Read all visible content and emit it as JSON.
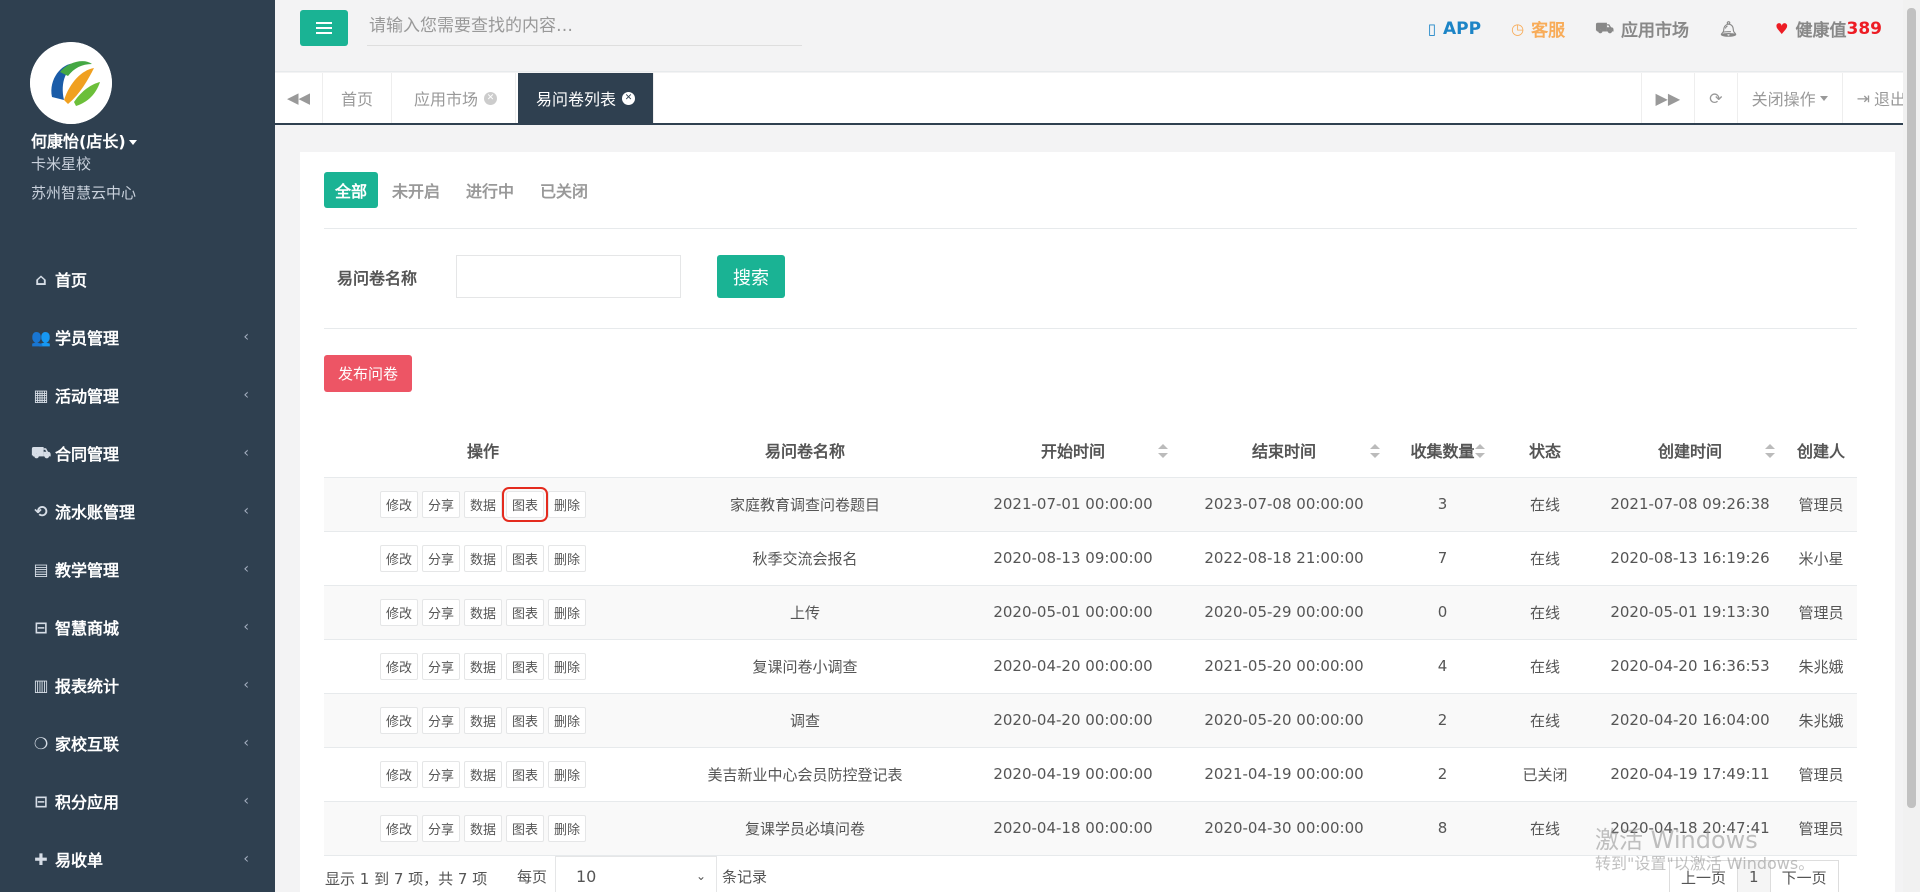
{
  "sidebar": {
    "user_name": "何康怡(店长)",
    "school": "卡米星校",
    "center": "苏州智慧云中心",
    "items": [
      {
        "label": "首页",
        "icon": "home-icon"
      },
      {
        "label": "学员管理",
        "icon": "users-icon"
      },
      {
        "label": "活动管理",
        "icon": "map-icon"
      },
      {
        "label": "合同管理",
        "icon": "cart-icon"
      },
      {
        "label": "流水账管理",
        "icon": "refresh-icon"
      },
      {
        "label": "教学管理",
        "icon": "calendar-icon"
      },
      {
        "label": "智慧商城",
        "icon": "inbox-icon"
      },
      {
        "label": "报表统计",
        "icon": "bar-chart-icon"
      },
      {
        "label": "家校互联",
        "icon": "comments-icon"
      },
      {
        "label": "积分应用",
        "icon": "inbox-icon"
      },
      {
        "label": "易收单",
        "icon": "user-plus-icon"
      }
    ]
  },
  "topbar": {
    "search_placeholder": "请输入您需要查找的内容…",
    "app_label": "APP",
    "kefu_label": "客服",
    "market_label": "应用市场",
    "health_label": "健康值",
    "health_value": "389"
  },
  "tabs": {
    "items": [
      "首页",
      "应用市场",
      "易问卷列表"
    ],
    "close_ops": "关闭操作",
    "logout": "退出"
  },
  "filters": {
    "items": [
      "全部",
      "未开启",
      "进行中",
      "已关闭"
    ]
  },
  "search": {
    "label": "易问卷名称",
    "button": "搜索",
    "publish": "发布问卷"
  },
  "table": {
    "headers": [
      "操作",
      "易问卷名称",
      "开始时间",
      "结束时间",
      "收集数量",
      "状态",
      "创建时间",
      "创建人"
    ],
    "op_labels": [
      "修改",
      "分享",
      "数据",
      "图表",
      "删除"
    ],
    "rows": [
      {
        "name": "家庭教育调查问卷题目",
        "start": "2021-07-01 00:00:00",
        "end": "2023-07-08 00:00:00",
        "count": "3",
        "status": "在线",
        "created": "2021-07-08 09:26:38",
        "creator": "管理员"
      },
      {
        "name": "秋季交流会报名",
        "start": "2020-08-13 09:00:00",
        "end": "2022-08-18 21:00:00",
        "count": "7",
        "status": "在线",
        "created": "2020-08-13 16:19:26",
        "creator": "米小星"
      },
      {
        "name": "上传",
        "start": "2020-05-01 00:00:00",
        "end": "2020-05-29 00:00:00",
        "count": "0",
        "status": "在线",
        "created": "2020-05-01 19:13:30",
        "creator": "管理员"
      },
      {
        "name": "复课问卷小调查",
        "start": "2020-04-20 00:00:00",
        "end": "2021-05-20 00:00:00",
        "count": "4",
        "status": "在线",
        "created": "2020-04-20 16:36:53",
        "creator": "朱兆娥"
      },
      {
        "name": "调查",
        "start": "2020-04-20 00:00:00",
        "end": "2020-05-20 00:00:00",
        "count": "2",
        "status": "在线",
        "created": "2020-04-20 16:04:00",
        "creator": "朱兆娥"
      },
      {
        "name": "美吉新业中心会员防控登记表",
        "start": "2020-04-19 00:00:00",
        "end": "2021-04-19 00:00:00",
        "count": "2",
        "status": "已关闭",
        "created": "2020-04-19 17:49:11",
        "creator": "管理员"
      },
      {
        "name": "复课学员必填问卷",
        "start": "2020-04-18 00:00:00",
        "end": "2020-04-30 00:00:00",
        "count": "8",
        "status": "在线",
        "created": "2020-04-18 20:47:41",
        "creator": "管理员"
      }
    ]
  },
  "footer": {
    "info": "显示 1 到 7 项，共 7 项",
    "per_page": "每页",
    "page_size": "10",
    "records": "条记录",
    "prev": "上一页",
    "page": "1",
    "next": "下一页"
  },
  "watermark": {
    "line1": "激活 Windows",
    "line2": "转到\"设置\"以激活 Windows。"
  },
  "colors": {
    "sidebar_bg": "#2f4050",
    "primary": "#1ab394",
    "danger": "#ed5565",
    "highlight": "#e42b1e"
  }
}
